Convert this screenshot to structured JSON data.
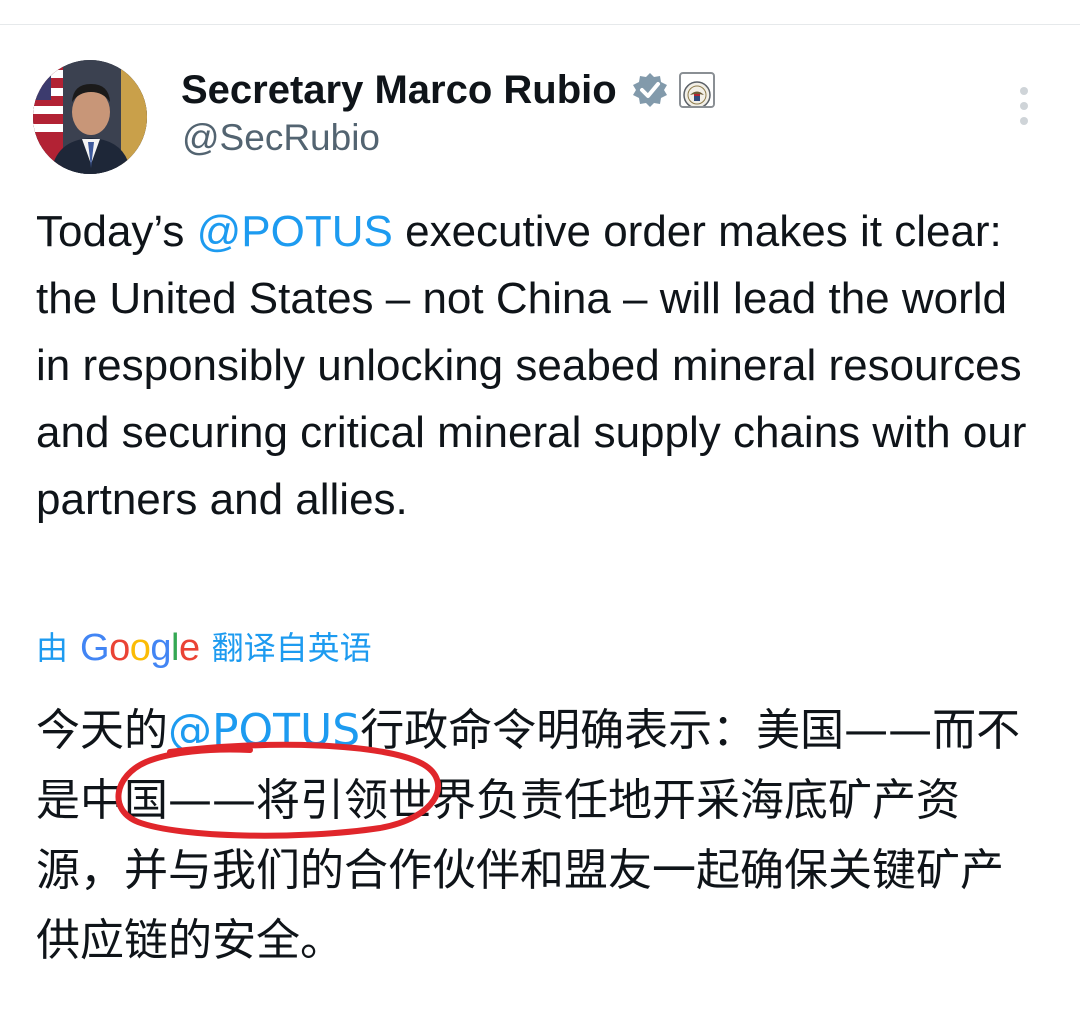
{
  "tweet": {
    "author": {
      "name": "Secretary Marco Rubio",
      "handle": "@SecRubio",
      "avatar_icon": "profile-photo",
      "verified_icon": "verified-badge-icon",
      "affiliation_icon": "state-department-seal-icon"
    },
    "menu_icon": "more-vertical-icon",
    "body": {
      "part1": "Today’s ",
      "mention": "@POTUS",
      "part2": " executive order makes it clear: the United States – not China – will lead the world in responsibly unlocking seabed mineral resources and securing critical mineral supply chains with our partners and allies."
    },
    "translation": {
      "prefix": "由",
      "provider": "Google",
      "suffix": "翻译自英语",
      "text_part1": "今天的",
      "mention": "@POTUS",
      "text_part2": "行政命令明确表示：美国——而不是中国——将引领世界负责任地开采海底矿产资源，并与我们的合作伙伴和盟友一起确保关键矿产供应链的安全。"
    }
  },
  "colors": {
    "mention": "#1d9bf0",
    "verified": "#829aab",
    "annotation_circle": "#e0262b"
  }
}
